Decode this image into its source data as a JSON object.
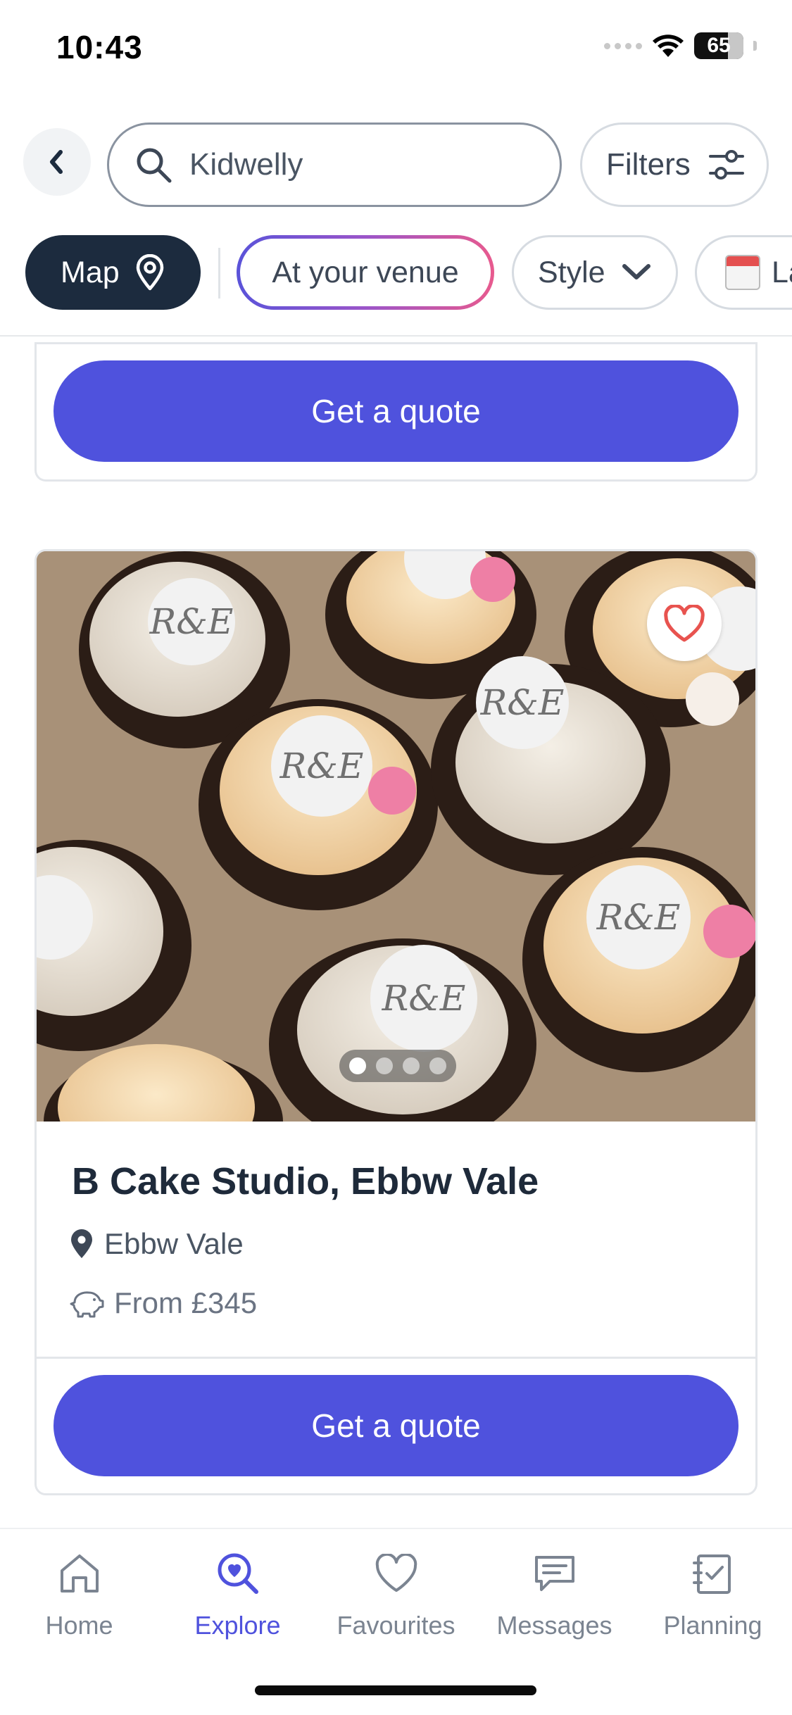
{
  "status_bar": {
    "time": "10:43",
    "battery": "65"
  },
  "search": {
    "value": "Kidwelly",
    "filters_label": "Filters"
  },
  "chips": {
    "map": "Map",
    "venue": "At your venue",
    "style": "Style",
    "last": "La"
  },
  "cards": {
    "top": {
      "quote_label": "Get a quote"
    },
    "main": {
      "title": "B Cake Studio, Ebbw Vale",
      "location": "Ebbw Vale",
      "price": "From £345",
      "quote_label": "Get a quote",
      "image_dots": 4,
      "active_dot": 1,
      "image_text": "R&E"
    }
  },
  "nav": {
    "items": [
      {
        "label": "Home",
        "icon": "home-icon"
      },
      {
        "label": "Explore",
        "icon": "explore-icon"
      },
      {
        "label": "Favourites",
        "icon": "heart-icon"
      },
      {
        "label": "Messages",
        "icon": "messages-icon"
      },
      {
        "label": "Planning",
        "icon": "planning-icon"
      }
    ],
    "active": "Explore"
  },
  "colors": {
    "primary": "#4f52dd",
    "dark_chip": "#1c2b3e",
    "favourite": "#e8534f",
    "text": "#1e2a3a"
  }
}
